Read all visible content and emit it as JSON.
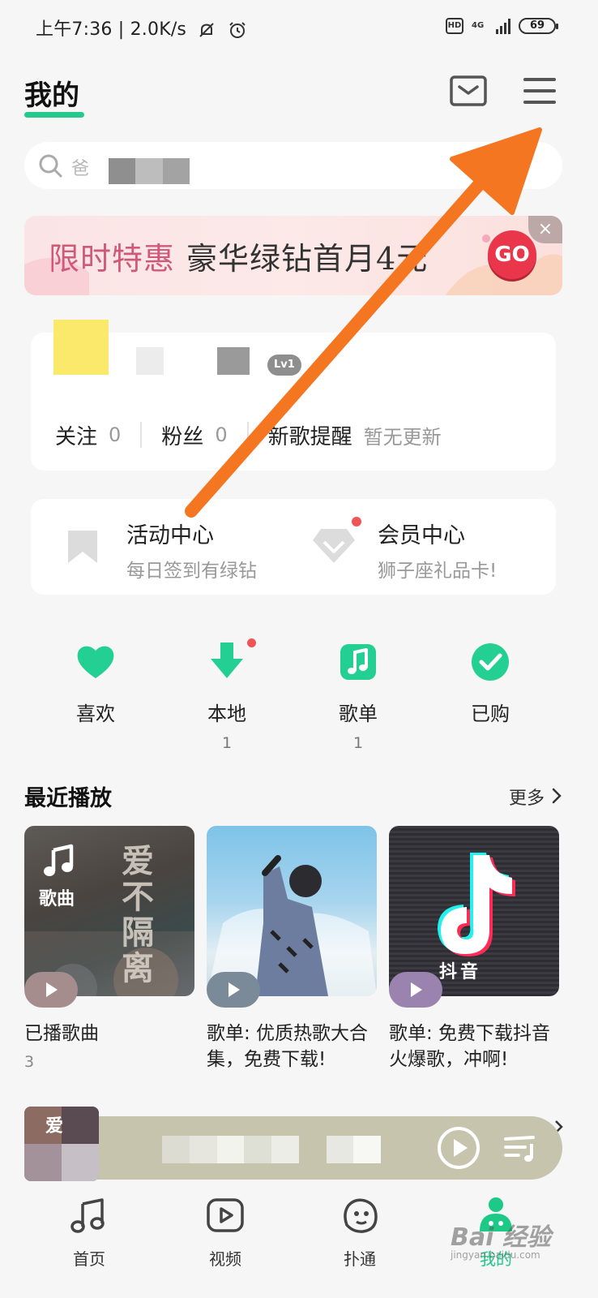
{
  "status_bar": {
    "time_speed": "上午7:36 | 2.0K/s",
    "hd": "HD",
    "network": "4G",
    "battery": "69"
  },
  "header": {
    "title": "我的",
    "icons": [
      "mail-icon",
      "menu-icon"
    ]
  },
  "search": {
    "placeholder": "爸"
  },
  "banner": {
    "text_left": "限时特惠",
    "text_right": "豪华绿钻首月4元",
    "go_label": "GO",
    "close_label": "×"
  },
  "profile": {
    "level": "Lv1",
    "follow_label": "关注",
    "follow_count": "0",
    "fans_label": "粉丝",
    "fans_count": "0",
    "new_song_label": "新歌提醒",
    "new_song_status": "暂无更新"
  },
  "centers": {
    "activity_title": "活动中心",
    "activity_sub": "每日签到有绿钻",
    "vip_title": "会员中心",
    "vip_sub": "狮子座礼品卡!"
  },
  "quick_actions": [
    {
      "label": "喜欢",
      "count": "",
      "icon": "heart-icon"
    },
    {
      "label": "本地",
      "count": "1",
      "icon": "download-icon"
    },
    {
      "label": "歌单",
      "count": "1",
      "icon": "music-note-icon"
    },
    {
      "label": "已购",
      "count": "",
      "icon": "check-icon"
    }
  ],
  "recent": {
    "title": "最近播放",
    "more_label": "更多",
    "items": [
      {
        "title": "已播歌曲",
        "count": "3",
        "cover_label": "歌曲",
        "cover_art_text": "爱不隔离"
      },
      {
        "title": "歌单: 优质热歌大合集，免费下载!",
        "count": ""
      },
      {
        "title": "歌单: 免费下载抖音火爆歌，冲啊!",
        "count": "",
        "cover_art_text": "抖音"
      }
    ]
  },
  "mini_player": {
    "cover_art_text": "爱"
  },
  "bottom_nav": [
    {
      "label": "首页",
      "icon": "music-note-icon"
    },
    {
      "label": "视频",
      "icon": "video-play-icon"
    },
    {
      "label": "扑通",
      "icon": "face-icon"
    },
    {
      "label": "我的",
      "icon": "profile-icon",
      "active": true
    }
  ],
  "watermark": {
    "text": "Bai 经验",
    "sub": "jingyan.baidu.com"
  },
  "colors": {
    "accent": "#24c98c",
    "banner_pink": "#cf5a78",
    "go_red": "#e9364b",
    "arrow": "#f47621"
  }
}
